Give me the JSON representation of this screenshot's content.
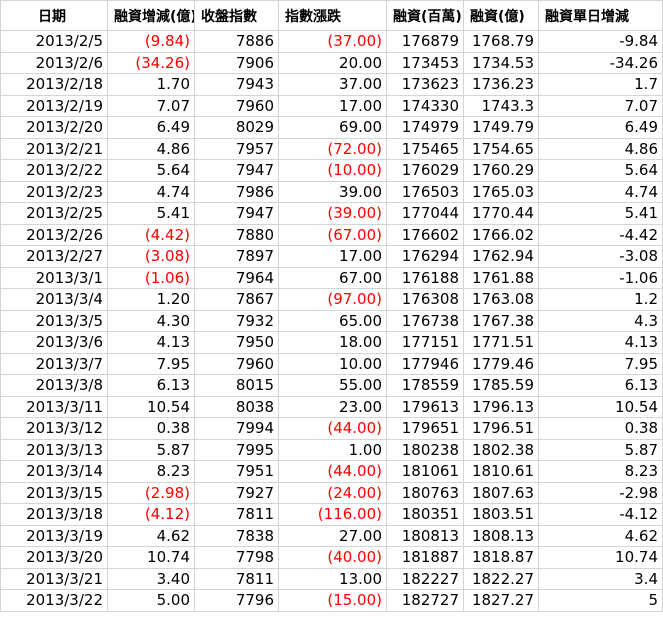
{
  "sheet": {
    "headers": [
      "日期",
      "融資增減(億)",
      "收盤指數",
      "指數漲跌",
      "融資(百萬)",
      "融資(億)",
      "融資單日增減"
    ],
    "negative_color": "#ff0000",
    "rows": [
      {
        "date": "2013/2/5",
        "chg": "(9.84)",
        "chg_neg": true,
        "close": "7886",
        "idx": "(37.00)",
        "idx_neg": true,
        "mil": "176879",
        "yi": "1768.79",
        "day": "-9.84"
      },
      {
        "date": "2013/2/6",
        "chg": "(34.26)",
        "chg_neg": true,
        "close": "7906",
        "idx": "20.00",
        "idx_neg": false,
        "mil": "173453",
        "yi": "1734.53",
        "day": "-34.26"
      },
      {
        "date": "2013/2/18",
        "chg": "1.70",
        "chg_neg": false,
        "close": "7943",
        "idx": "37.00",
        "idx_neg": false,
        "mil": "173623",
        "yi": "1736.23",
        "day": "1.7"
      },
      {
        "date": "2013/2/19",
        "chg": "7.07",
        "chg_neg": false,
        "close": "7960",
        "idx": "17.00",
        "idx_neg": false,
        "mil": "174330",
        "yi": "1743.3",
        "day": "7.07"
      },
      {
        "date": "2013/2/20",
        "chg": "6.49",
        "chg_neg": false,
        "close": "8029",
        "idx": "69.00",
        "idx_neg": false,
        "mil": "174979",
        "yi": "1749.79",
        "day": "6.49"
      },
      {
        "date": "2013/2/21",
        "chg": "4.86",
        "chg_neg": false,
        "close": "7957",
        "idx": "(72.00)",
        "idx_neg": true,
        "mil": "175465",
        "yi": "1754.65",
        "day": "4.86"
      },
      {
        "date": "2013/2/22",
        "chg": "5.64",
        "chg_neg": false,
        "close": "7947",
        "idx": "(10.00)",
        "idx_neg": true,
        "mil": "176029",
        "yi": "1760.29",
        "day": "5.64"
      },
      {
        "date": "2013/2/23",
        "chg": "4.74",
        "chg_neg": false,
        "close": "7986",
        "idx": "39.00",
        "idx_neg": false,
        "mil": "176503",
        "yi": "1765.03",
        "day": "4.74"
      },
      {
        "date": "2013/2/25",
        "chg": "5.41",
        "chg_neg": false,
        "close": "7947",
        "idx": "(39.00)",
        "idx_neg": true,
        "mil": "177044",
        "yi": "1770.44",
        "day": "5.41"
      },
      {
        "date": "2013/2/26",
        "chg": "(4.42)",
        "chg_neg": true,
        "close": "7880",
        "idx": "(67.00)",
        "idx_neg": true,
        "mil": "176602",
        "yi": "1766.02",
        "day": "-4.42"
      },
      {
        "date": "2013/2/27",
        "chg": "(3.08)",
        "chg_neg": true,
        "close": "7897",
        "idx": "17.00",
        "idx_neg": false,
        "mil": "176294",
        "yi": "1762.94",
        "day": "-3.08"
      },
      {
        "date": "2013/3/1",
        "chg": "(1.06)",
        "chg_neg": true,
        "close": "7964",
        "idx": "67.00",
        "idx_neg": false,
        "mil": "176188",
        "yi": "1761.88",
        "day": "-1.06"
      },
      {
        "date": "2013/3/4",
        "chg": "1.20",
        "chg_neg": false,
        "close": "7867",
        "idx": "(97.00)",
        "idx_neg": true,
        "mil": "176308",
        "yi": "1763.08",
        "day": "1.2"
      },
      {
        "date": "2013/3/5",
        "chg": "4.30",
        "chg_neg": false,
        "close": "7932",
        "idx": "65.00",
        "idx_neg": false,
        "mil": "176738",
        "yi": "1767.38",
        "day": "4.3"
      },
      {
        "date": "2013/3/6",
        "chg": "4.13",
        "chg_neg": false,
        "close": "7950",
        "idx": "18.00",
        "idx_neg": false,
        "mil": "177151",
        "yi": "1771.51",
        "day": "4.13"
      },
      {
        "date": "2013/3/7",
        "chg": "7.95",
        "chg_neg": false,
        "close": "7960",
        "idx": "10.00",
        "idx_neg": false,
        "mil": "177946",
        "yi": "1779.46",
        "day": "7.95"
      },
      {
        "date": "2013/3/8",
        "chg": "6.13",
        "chg_neg": false,
        "close": "8015",
        "idx": "55.00",
        "idx_neg": false,
        "mil": "178559",
        "yi": "1785.59",
        "day": "6.13"
      },
      {
        "date": "2013/3/11",
        "chg": "10.54",
        "chg_neg": false,
        "close": "8038",
        "idx": "23.00",
        "idx_neg": false,
        "mil": "179613",
        "yi": "1796.13",
        "day": "10.54"
      },
      {
        "date": "2013/3/12",
        "chg": "0.38",
        "chg_neg": false,
        "close": "7994",
        "idx": "(44.00)",
        "idx_neg": true,
        "mil": "179651",
        "yi": "1796.51",
        "day": "0.38"
      },
      {
        "date": "2013/3/13",
        "chg": "5.87",
        "chg_neg": false,
        "close": "7995",
        "idx": "1.00",
        "idx_neg": false,
        "mil": "180238",
        "yi": "1802.38",
        "day": "5.87"
      },
      {
        "date": "2013/3/14",
        "chg": "8.23",
        "chg_neg": false,
        "close": "7951",
        "idx": "(44.00)",
        "idx_neg": true,
        "mil": "181061",
        "yi": "1810.61",
        "day": "8.23"
      },
      {
        "date": "2013/3/15",
        "chg": "(2.98)",
        "chg_neg": true,
        "close": "7927",
        "idx": "(24.00)",
        "idx_neg": true,
        "mil": "180763",
        "yi": "1807.63",
        "day": "-2.98"
      },
      {
        "date": "2013/3/18",
        "chg": "(4.12)",
        "chg_neg": true,
        "close": "7811",
        "idx": "(116.00)",
        "idx_neg": true,
        "mil": "180351",
        "yi": "1803.51",
        "day": "-4.12"
      },
      {
        "date": "2013/3/19",
        "chg": "4.62",
        "chg_neg": false,
        "close": "7838",
        "idx": "27.00",
        "idx_neg": false,
        "mil": "180813",
        "yi": "1808.13",
        "day": "4.62"
      },
      {
        "date": "2013/3/20",
        "chg": "10.74",
        "chg_neg": false,
        "close": "7798",
        "idx": "(40.00)",
        "idx_neg": true,
        "mil": "181887",
        "yi": "1818.87",
        "day": "10.74"
      },
      {
        "date": "2013/3/21",
        "chg": "3.40",
        "chg_neg": false,
        "close": "7811",
        "idx": "13.00",
        "idx_neg": false,
        "mil": "182227",
        "yi": "1822.27",
        "day": "3.4"
      },
      {
        "date": "2013/3/22",
        "chg": "5.00",
        "chg_neg": false,
        "close": "7796",
        "idx": "(15.00)",
        "idx_neg": true,
        "mil": "182727",
        "yi": "1827.27",
        "day": "5"
      }
    ]
  }
}
